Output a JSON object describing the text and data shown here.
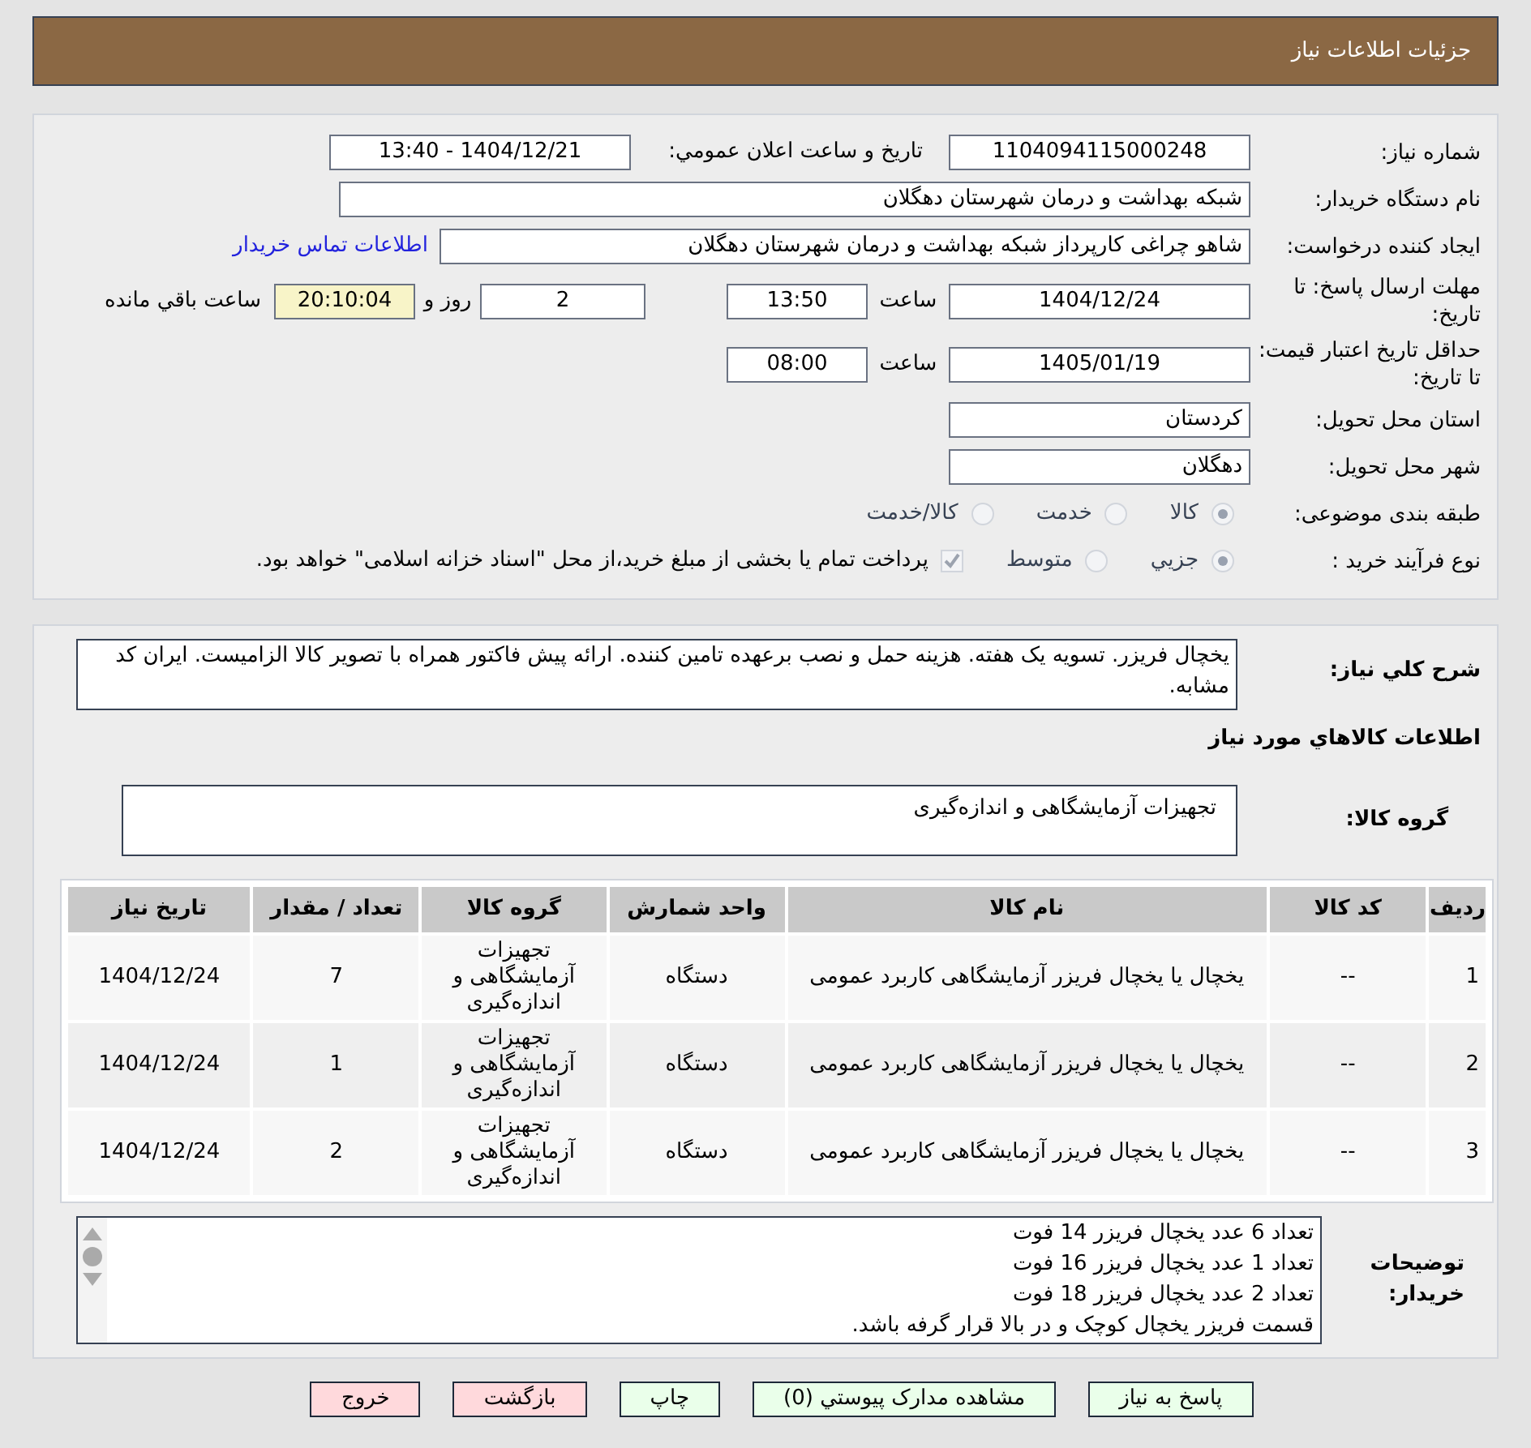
{
  "header": {
    "title": "جزئيات اطلاعات نياز"
  },
  "need_number": {
    "label": "شماره نياز:",
    "value": "1104094115000248"
  },
  "announce": {
    "label": "تاريخ و ساعت اعلان عمومي:",
    "value": "1404/12/21 - 13:40"
  },
  "buyer_org": {
    "label": "نام دستگاه خريدار:",
    "value": "شبکه بهداشت و درمان شهرستان دهگلان"
  },
  "requester": {
    "label": "ايجاد کننده درخواست:",
    "value": "شاهو چراغی کارپرداز شبکه بهداشت و درمان شهرستان دهگلان",
    "link": "اطلاعات تماس خريدار"
  },
  "deadline": {
    "label": "مهلت ارسال پاسخ: تا تاريخ:",
    "date": "1404/12/24",
    "time_label": "ساعت",
    "time": "13:50",
    "days": "2",
    "days_label": "روز و",
    "remaining": "20:10:04",
    "remaining_label": "ساعت باقي مانده"
  },
  "validity": {
    "label": "حداقل تاريخ اعتبار قيمت: تا تاريخ:",
    "date": "1405/01/19",
    "time_label": "ساعت",
    "time": "08:00"
  },
  "province": {
    "label": "استان محل تحويل:",
    "value": "کردستان"
  },
  "city": {
    "label": "شهر محل تحويل:",
    "value": "دهگلان"
  },
  "category": {
    "label": "طبقه بندی موضوعی:",
    "options": [
      {
        "label": "کالا",
        "selected": true
      },
      {
        "label": "خدمت",
        "selected": false
      },
      {
        "label": "کالا/خدمت",
        "selected": false
      }
    ]
  },
  "process": {
    "label": "نوع فرآيند خريد :",
    "options": [
      {
        "label": "جزيي",
        "selected": true
      },
      {
        "label": "متوسط",
        "selected": false
      }
    ],
    "payment": {
      "checked": true,
      "label": "پرداخت تمام يا بخشی از مبلغ خريد،از محل \"اسناد خزانه اسلامی\" خواهد بود."
    }
  },
  "description": {
    "label": "شرح کلي نياز:",
    "value": "يخچال فريزر. تسويه يک هفته. هزينه حمل و نصب برعهده تامين کننده. ارائه پيش فاکتور همراه با تصوير کالا الزاميست. ايران کد مشابه."
  },
  "goods_heading": "اطلاعات کالاهاي مورد نياز",
  "goods_group": {
    "label": "گروه کالا:",
    "value": "تجهيزات آزمايشگاهی و اندازه‌گيری"
  },
  "table": {
    "columns": [
      "رديف",
      "کد کالا",
      "نام کالا",
      "واحد شمارش",
      "گروه کالا",
      "تعداد / مقدار",
      "تاريخ نياز"
    ],
    "rows": [
      [
        "1",
        "--",
        "يخچال يا يخچال فريزر آزمايشگاهی کاربرد عمومی",
        "دستگاه",
        "تجهيزات آزمايشگاهی و اندازه‌گيری",
        "7",
        "1404/12/24"
      ],
      [
        "2",
        "--",
        "يخچال يا يخچال فريزر آزمايشگاهی کاربرد عمومی",
        "دستگاه",
        "تجهيزات آزمايشگاهی و اندازه‌گيری",
        "1",
        "1404/12/24"
      ],
      [
        "3",
        "--",
        "يخچال يا يخچال فريزر آزمايشگاهی کاربرد عمومی",
        "دستگاه",
        "تجهيزات آزمايشگاهی و اندازه‌گيری",
        "2",
        "1404/12/24"
      ]
    ]
  },
  "buyer_notes": {
    "label": "توضيحات خريدار:",
    "lines": [
      "تعداد 6 عدد يخچال فريزر 14 فوت",
      "تعداد 1 عدد يخچال فريزر 16 فوت",
      "تعداد 2 عدد يخچال فريزر 18 فوت",
      "قسمت فريزر يخچال کوچک و در بالا قرار گرفه باشد."
    ]
  },
  "buttons": [
    {
      "label": "پاسخ به نياز",
      "kind": "primary"
    },
    {
      "label": "مشاهده مدارک پيوستي (0)",
      "kind": "primary"
    },
    {
      "label": "چاپ",
      "kind": "primary"
    },
    {
      "label": "بازگشت",
      "kind": "danger"
    },
    {
      "label": "خروج",
      "kind": "danger"
    }
  ]
}
